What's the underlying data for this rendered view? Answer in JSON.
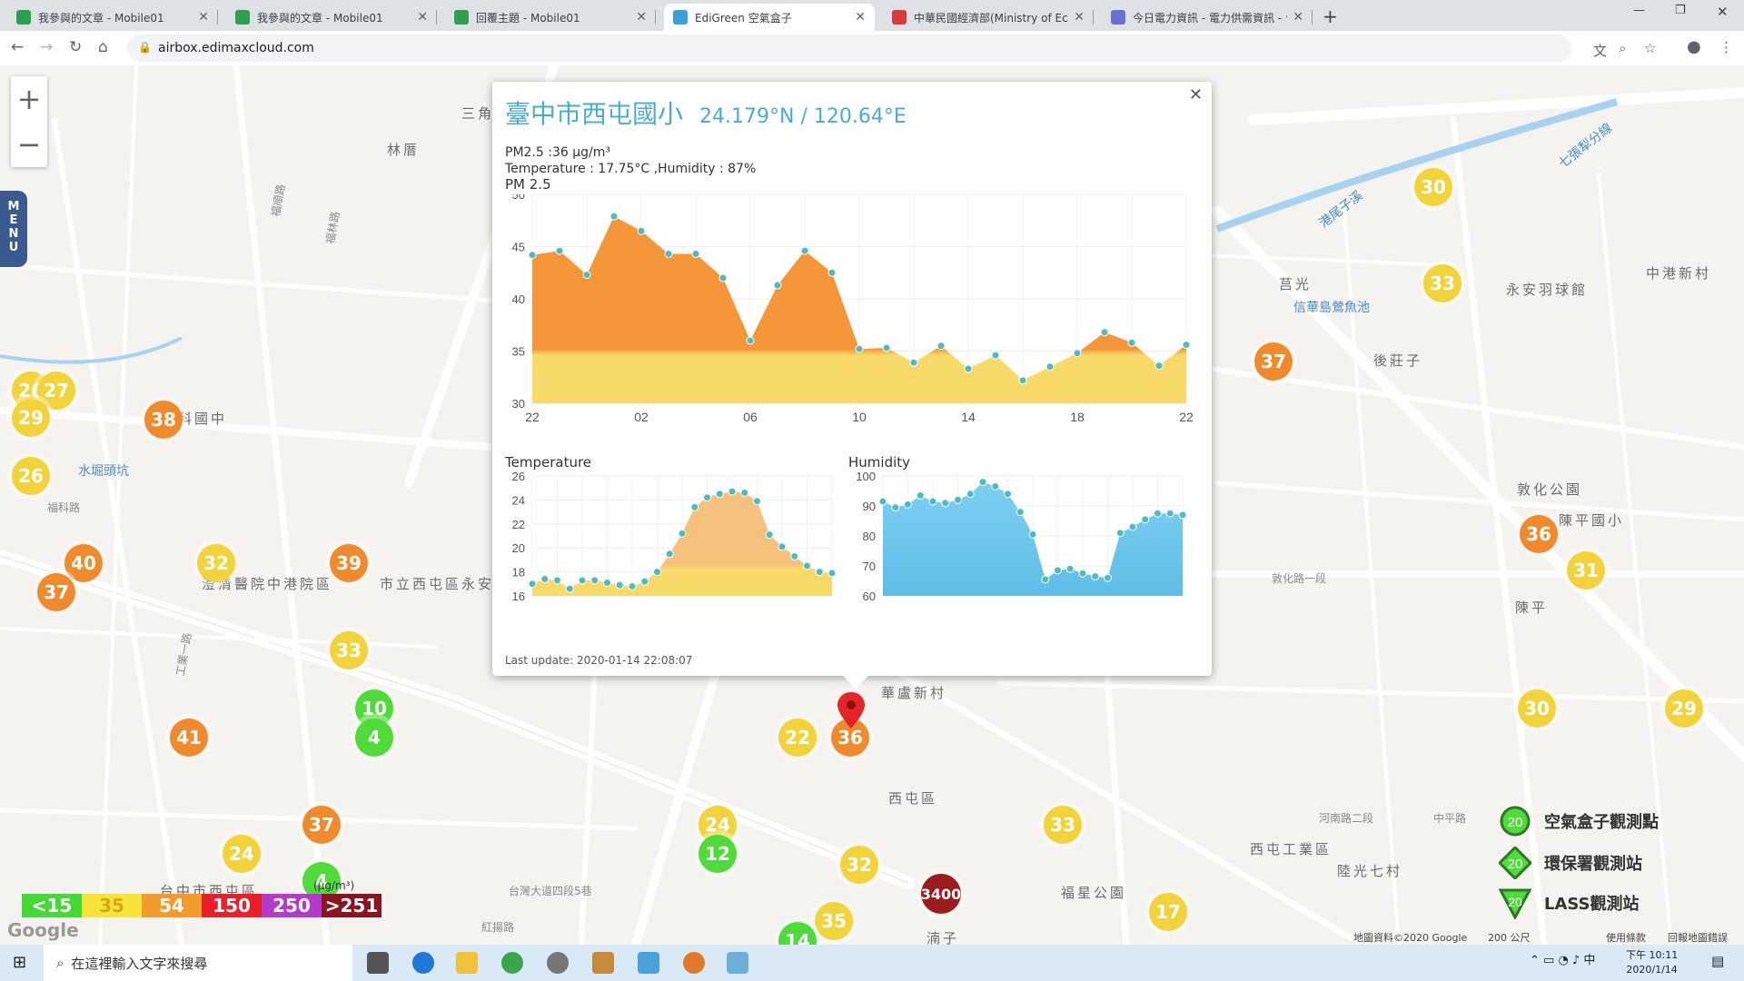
{
  "browser": {
    "tabs": [
      {
        "title": "我參與的文章 - Mobile01",
        "color": "#2e9e4f"
      },
      {
        "title": "我參與的文章 - Mobile01",
        "color": "#2e9e4f"
      },
      {
        "title": "回覆主題 - Mobile01",
        "color": "#2e9e4f"
      },
      {
        "title": "EdiGreen 空氣盒子",
        "color": "#3aa0d8"
      },
      {
        "title": "中華民國經濟部(Ministry of Eco",
        "color": "#d93a3a"
      },
      {
        "title": "今日電力資訊 - 電力供需資訊 - 台",
        "color": "#6a6fd3"
      }
    ],
    "active_tab": 3,
    "url": "airbox.edimaxcloud.com"
  },
  "map": {
    "menu_label": "MENU",
    "place_labels": [
      "三角",
      "林厝",
      "莒光",
      "後莊子",
      "中港新村",
      "永安羽球館",
      "信華島鶯魚池",
      "敦化公園",
      "陳平國小",
      "陳平",
      "華盧新村",
      "西屯區",
      "西屯工業區",
      "陸光七村",
      "福星公園",
      "湳子",
      "水堀頭坑",
      "市立西屯區永安國",
      "港尾子溪",
      "七張犁分線",
      "澄清醫院中港院區",
      "中科國中",
      "台中市西屯區"
    ],
    "road_labels": [
      "福科路",
      "福林路",
      "福順路",
      "工業一路",
      "河南路二段",
      "台灣大道四段5巷",
      "紅揚路",
      "中平路",
      "敦化路一段"
    ],
    "markers": [
      {
        "value": "26",
        "color": "#f2d33a"
      },
      {
        "value": "27",
        "color": "#f2d33a"
      },
      {
        "value": "29",
        "color": "#f2d33a"
      },
      {
        "value": "38",
        "color": "#f08a2c"
      },
      {
        "value": "26",
        "color": "#f2d33a"
      },
      {
        "value": "40",
        "color": "#f08a2c"
      },
      {
        "value": "37",
        "color": "#f08a2c"
      },
      {
        "value": "32",
        "color": "#f2d33a"
      },
      {
        "value": "39",
        "color": "#f08a2c"
      },
      {
        "value": "33",
        "color": "#f2d33a"
      },
      {
        "value": "10",
        "color": "#4fdc3a"
      },
      {
        "value": "4",
        "color": "#4fdc3a"
      },
      {
        "value": "41",
        "color": "#f08a2c"
      },
      {
        "value": "37",
        "color": "#f08a2c"
      },
      {
        "value": "24",
        "color": "#f2d33a"
      },
      {
        "value": "4",
        "color": "#4fdc3a"
      },
      {
        "value": "22",
        "color": "#f2d33a"
      },
      {
        "value": "36",
        "color": "#f08a2c"
      },
      {
        "value": "24",
        "color": "#f2d33a"
      },
      {
        "value": "12",
        "color": "#4fdc3a"
      },
      {
        "value": "32",
        "color": "#f2d33a"
      },
      {
        "value": "35",
        "color": "#f2d33a"
      },
      {
        "value": "14",
        "color": "#4fdc3a"
      },
      {
        "value": "3400",
        "color": "#9b1c1c"
      },
      {
        "value": "33",
        "color": "#f2d33a"
      },
      {
        "value": "17",
        "color": "#f2d33a"
      },
      {
        "value": "30",
        "color": "#f2d33a"
      },
      {
        "value": "33",
        "color": "#f2d33a"
      },
      {
        "value": "37",
        "color": "#f08a2c"
      },
      {
        "value": "36",
        "color": "#f08a2c"
      },
      {
        "value": "31",
        "color": "#f2d33a"
      },
      {
        "value": "30",
        "color": "#f2d33a"
      },
      {
        "value": "29",
        "color": "#f2d33a"
      }
    ],
    "aqi_scale": [
      {
        "label": "<15",
        "color": "#46d936"
      },
      {
        "label": "35",
        "color": "#f6e43a"
      },
      {
        "label": "54",
        "color": "#f29a2c"
      },
      {
        "label": "150",
        "color": "#e8202a"
      },
      {
        "label": "250",
        "color": "#b43ac8"
      },
      {
        "label": ">251",
        "color": "#8a1421"
      }
    ],
    "unit": "(µg/m³)",
    "google": "Google",
    "station_legend": [
      {
        "value": "20",
        "label": "空氣盒子觀測點"
      },
      {
        "value": "20",
        "label": "環保署觀測站"
      },
      {
        "value": "20",
        "label": "LASS觀測站"
      }
    ],
    "footer": {
      "map_data": "地圖資料©2020 Google",
      "scale": "200 公尺",
      "terms": "使用條款",
      "report": "回報地圖錯誤"
    }
  },
  "popup": {
    "title": "臺中市西屯國小",
    "coordinates": "24.179°N / 120.64°E",
    "pm25_line": "PM2.5 :36 µg/m³",
    "env_line": "Temperature : 17.75°C ,Humidity : 87%",
    "last_update": "Last update: 2020-01-14 22:08:07"
  },
  "chart_data": [
    {
      "type": "area",
      "title": "PM 2.5",
      "x_tick_labels": [
        "22",
        "02",
        "06",
        "10",
        "14",
        "18",
        "22"
      ],
      "ylim": [
        30,
        50
      ],
      "y_ticks": [
        30,
        35,
        40,
        45,
        50
      ],
      "threshold": 35,
      "color_above": "#f5963a",
      "color_below": "#f7da6a",
      "values": [
        44.2,
        44.6,
        42.3,
        47.9,
        46.5,
        44.3,
        44.3,
        42.0,
        36.0,
        41.3,
        44.6,
        42.5,
        35.2,
        35.3,
        33.9,
        35.5,
        33.3,
        34.6,
        32.2,
        33.5,
        34.8,
        36.8,
        35.8,
        33.6,
        35.6
      ],
      "grid": true
    },
    {
      "type": "area",
      "title": "Temperature",
      "ylim": [
        16,
        26
      ],
      "y_ticks": [
        16,
        18,
        20,
        22,
        24,
        26
      ],
      "threshold": 18.5,
      "color_above": "#f5c27e",
      "color_below": "#f7da6a",
      "values": [
        17.0,
        17.4,
        17.3,
        16.6,
        17.3,
        17.3,
        17.1,
        16.9,
        16.8,
        17.2,
        18.0,
        19.5,
        21.2,
        23.4,
        24.2,
        24.5,
        24.7,
        24.6,
        23.9,
        21.1,
        20.1,
        19.3,
        18.5,
        18.0,
        17.9
      ],
      "grid": true
    },
    {
      "type": "area",
      "title": "Humidity",
      "ylim": [
        60,
        100
      ],
      "y_ticks": [
        60,
        70,
        80,
        90,
        100
      ],
      "color": "#5fbde6",
      "values": [
        91.5,
        89.5,
        90.5,
        93.5,
        91.5,
        91.0,
        92.0,
        94.0,
        98.0,
        96.5,
        94.0,
        88.0,
        80.5,
        65.5,
        68.5,
        69.0,
        67.5,
        66.5,
        66.0,
        81.0,
        83.0,
        85.5,
        87.5,
        87.5,
        87.0
      ],
      "grid": true
    }
  ],
  "taskbar": {
    "search_placeholder": "在這裡輸入文字來搜尋",
    "time": "下午 10:11",
    "date": "2020/1/14"
  }
}
